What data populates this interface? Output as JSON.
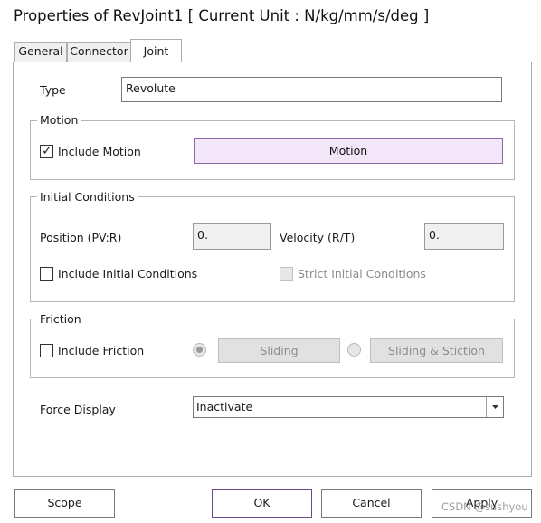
{
  "window": {
    "title": "Properties of RevJoint1 [ Current Unit : N/kg/mm/s/deg ]"
  },
  "tabs": [
    {
      "label": "General"
    },
    {
      "label": "Connector"
    },
    {
      "label": "Joint"
    }
  ],
  "joint": {
    "type_label": "Type",
    "type_value": "Revolute",
    "motion": {
      "group_title": "Motion",
      "include_label": "Include Motion",
      "include_checked": true,
      "button_label": "Motion"
    },
    "initial_conditions": {
      "group_title": "Initial Conditions",
      "position_label": "Position (PV:R)",
      "position_value": "0.",
      "velocity_label": "Velocity (R/T)",
      "velocity_value": "0.",
      "include_label": "Include Initial Conditions",
      "strict_label": "Strict Initial Conditions"
    },
    "friction": {
      "group_title": "Friction",
      "include_label": "Include Friction",
      "sliding_label": "Sliding",
      "stiction_label": "Sliding & Stiction"
    },
    "force_display": {
      "label": "Force Display",
      "value": "Inactivate"
    }
  },
  "footer": {
    "scope_label": "Scope",
    "ok_label": "OK",
    "cancel_label": "Cancel",
    "apply_label": "Apply"
  },
  "watermark": "CSDN @sushyou",
  "icons": {
    "check": "check-mark-icon",
    "dropdown": "chevron-down-icon",
    "radio": "radio-icon"
  }
}
